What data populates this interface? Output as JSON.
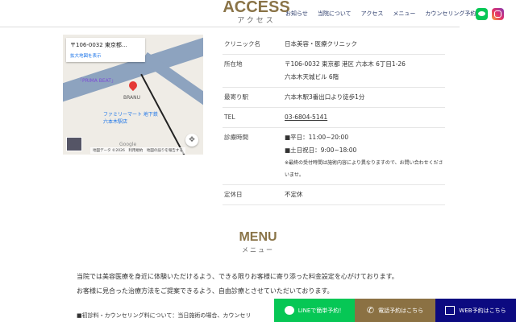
{
  "access": {
    "title": "ACCESS",
    "subtitle": "アクセス"
  },
  "nav": [
    "お知らせ",
    "当院について",
    "アクセス",
    "メニュー",
    "カウンセリング予約"
  ],
  "map": {
    "card_address": "〒106-0032 東京都...",
    "card_link": "拡大地図を表示",
    "poi1": "「PRIMA BEAT」",
    "poi2": "ファミリーマート 地下鉄六本木駅店",
    "poi3": "BRANU",
    "footer": "地図データ ©2026　利用規約　地図の誤りを報告する",
    "google": "Google"
  },
  "info": [
    {
      "label": "クリニック名",
      "lines": [
        "日本美容・医療クリニック"
      ]
    },
    {
      "label": "所在地",
      "lines": [
        "〒106-0032 東京都 港区 六本木 6丁目1-26",
        "六本木天城ビル 6階"
      ]
    },
    {
      "label": "最寄り駅",
      "lines": [
        "六本木駅3番出口より徒歩1分"
      ]
    },
    {
      "label": "TEL",
      "lines": [
        "03-6804-5141"
      ]
    },
    {
      "label": "診療時間",
      "lines": [
        "■平日：11:00~20:00",
        "■土日祝日：9:00~18:00"
      ],
      "note": "※最終の受付時間は施術内容により異なりますので、お問い合わせくださいませ。"
    },
    {
      "label": "定休日",
      "lines": [
        "不定休"
      ]
    }
  ],
  "menu": {
    "title": "MENU",
    "subtitle": "メニュー",
    "p1": "当院では美容医療を身近に体験いただけるよう、できる限りお客様に寄り添った料金設定を心がけております。",
    "p2": "お客様に見合った治療方法をご提案できるよう、自由診療とさせていただいております。",
    "p3": "■初診料・カウンセリング料について：当日施術の場合、カウンセリ"
  },
  "cta": {
    "line": "LINEで簡単予約！",
    "phone": "電話予約はこちら",
    "web": "WEB予約はこちら"
  },
  "colors": {
    "gold": "#8a7448",
    "line": "#06c755",
    "phone": "#8b7143",
    "web": "#0c0a80"
  }
}
